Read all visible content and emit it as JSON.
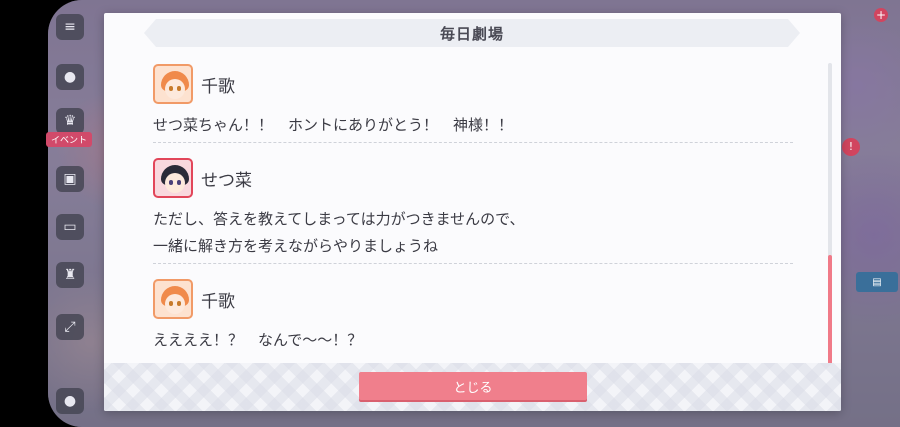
{
  "dialog": {
    "title": "毎日劇場",
    "close_label": "とじる"
  },
  "log": [
    {
      "speaker": "千歌",
      "avatar": "chika-avatar",
      "lines": [
        "せつ菜ちゃん！！　ホントにありがとう！　神様！！"
      ]
    },
    {
      "speaker": "せつ菜",
      "avatar": "setsuna-avatar",
      "lines": [
        "ただし、答えを教えてしまっては力がつきませんので、",
        "一緒に解き方を考えながらやりましょうね"
      ]
    },
    {
      "speaker": "千歌",
      "avatar": "chika-avatar",
      "lines": [
        "ええええ！？　なんで〜〜！？"
      ]
    }
  ],
  "background": {
    "side_badge": "イベント"
  },
  "colors": {
    "accent": "#f07f8c",
    "chika_frame": "#f19a67",
    "setsuna_frame": "#e2465a",
    "text": "#3b3b44"
  }
}
